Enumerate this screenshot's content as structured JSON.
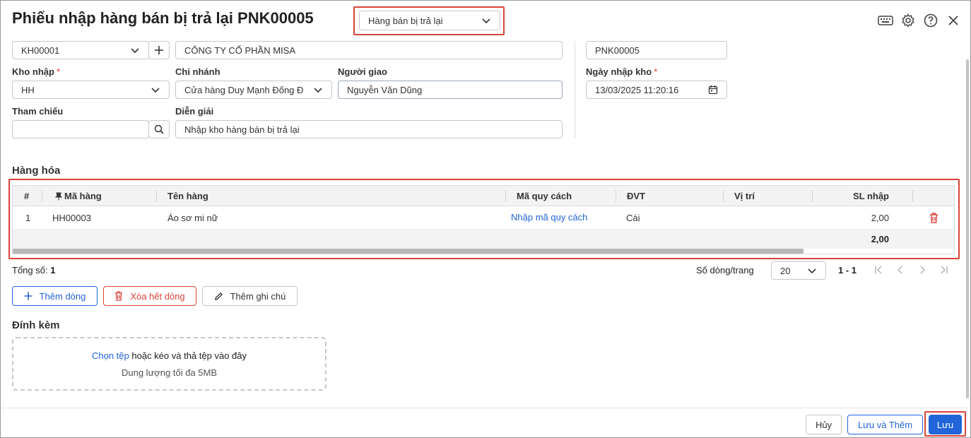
{
  "header": {
    "title": "Phiếu nhập hàng bán bị trả lại PNK00005",
    "type_select": "Hàng bán bị trả lại"
  },
  "form": {
    "customer_code": "KH00001",
    "customer_name": "CÔNG TY CỔ PHẦN MISA",
    "voucher_no": "PNK00005",
    "warehouse_label": "Kho nhập",
    "warehouse_value": "HH",
    "branch_label": "Chi nhánh",
    "branch_value": "Cửa hàng Duy Mạnh Đống Đ",
    "deliverer_label": "Người giao",
    "deliverer_value": "Nguyễn Văn Dũng",
    "date_label": "Ngày nhập kho",
    "date_value": "13/03/2025 11:20:16",
    "reference_label": "Tham chiếu",
    "reference_value": "",
    "description_label": "Diễn giải",
    "description_value": "Nhập kho hàng bán bị trả lại",
    "required_mark": "*"
  },
  "goods": {
    "section_title": "Hàng hóa",
    "columns": [
      "#",
      "Mã hàng",
      "Tên hàng",
      "Mã quy cách",
      "ĐVT",
      "Vị trí",
      "SL nhập"
    ],
    "rows": [
      {
        "no": "1",
        "code": "HH00003",
        "name": "Áo sơ mi nữ",
        "spec": "Nhập mã quy cách",
        "unit": "Cái",
        "location": "",
        "qty": "2,00"
      }
    ],
    "total_qty": "2,00"
  },
  "pagination": {
    "total_label": "Tổng số:",
    "total_value": "1",
    "rows_per_page_label": "Số dòng/trang",
    "rows_per_page": "20",
    "range": "1 - 1"
  },
  "actions": {
    "add_row": "Thêm dòng",
    "delete_all": "Xóa hết dòng",
    "add_note": "Thêm ghi chú"
  },
  "attachment": {
    "title": "Đính kèm",
    "choose_file": "Chọn tệp",
    "drag_text": "hoặc kéo và thả tệp vào đây",
    "size_limit": "Dung lượng tối đa 5MB"
  },
  "footer": {
    "cancel": "Hủy",
    "save_and_add": "Lưu và Thêm",
    "save": "Lưu"
  },
  "colors": {
    "accent": "#2265d8",
    "danger": "#d9433a",
    "highlight": "#d9433a"
  }
}
